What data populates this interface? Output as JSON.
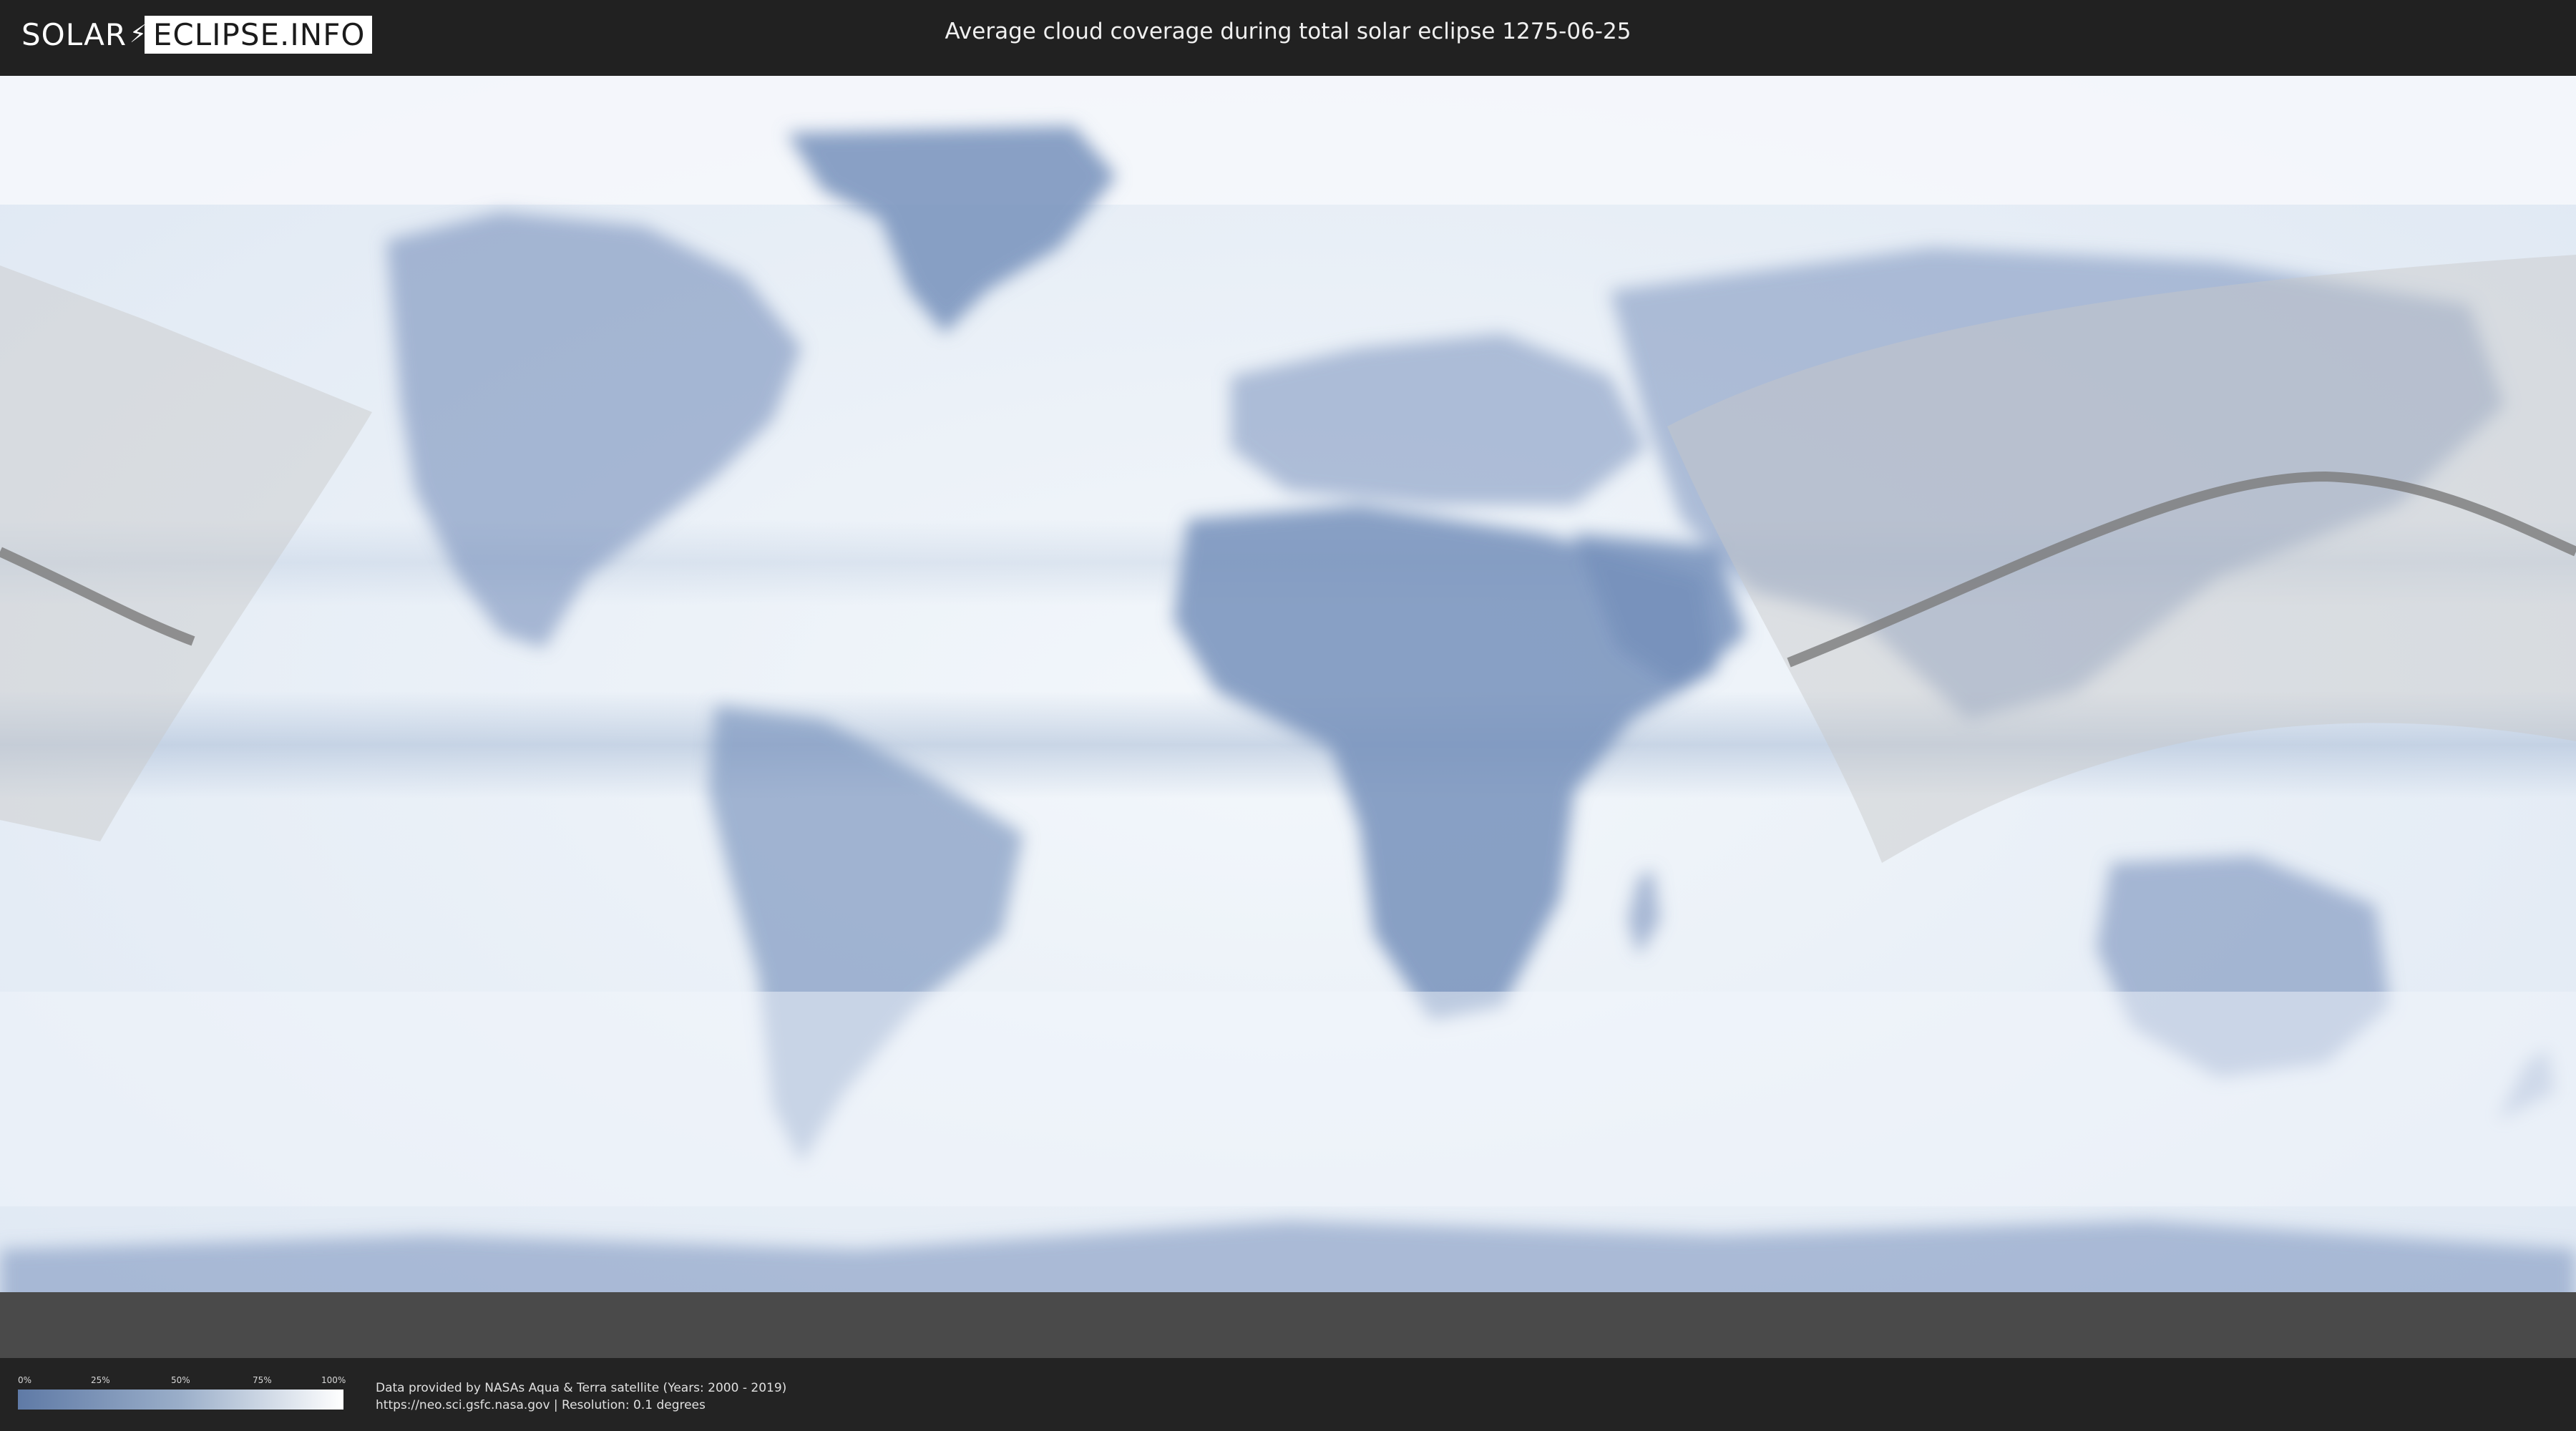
{
  "header": {
    "logo_left": "SOLAR",
    "logo_right": "ECLIPSE.INFO",
    "title": "Average cloud coverage during total solar eclipse 1275-06-25"
  },
  "map": {
    "ocean_color": "#e9eff7",
    "land_color": "#6f88b3",
    "eclipse_path_color": "#7a7a7a",
    "visibility_shade_color": "#c8c8c8"
  },
  "legend": {
    "ticks": [
      "0%",
      "25%",
      "50%",
      "75%",
      "100%"
    ]
  },
  "footer": {
    "line1": "Data provided by NASAs Aqua & Terra satellite (Years: 2000 - 2019)",
    "line2": "https://neo.sci.gsfc.nasa.gov | Resolution: 0.1 degrees"
  }
}
